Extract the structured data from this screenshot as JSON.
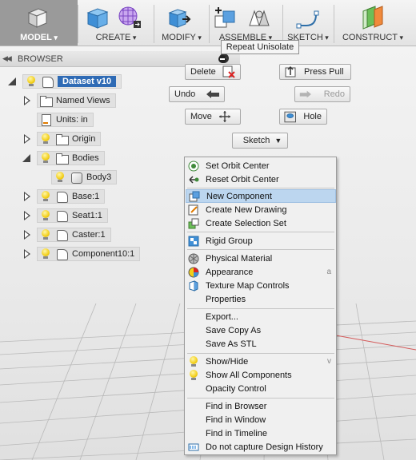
{
  "toolbar": {
    "groups": [
      {
        "label": "MODEL",
        "icon": "model-cube-icon"
      },
      {
        "label": "CREATE",
        "icon": "create-box-icon"
      },
      {
        "label": "MODIFY",
        "icon": "modify-icon"
      },
      {
        "label": "ASSEMBLE",
        "icon": "assemble-icon"
      },
      {
        "label": "SKETCH",
        "icon": "sketch-icon"
      },
      {
        "label": "CONSTRUCT",
        "icon": "construct-icon"
      }
    ]
  },
  "browser": {
    "title": "BROWSER",
    "items": [
      {
        "label": "Dataset v10",
        "icon": "component-icon",
        "visible_bulb": true,
        "expanded": true,
        "selected": true
      },
      {
        "label": "Named Views",
        "icon": "folder-icon",
        "expanded": false
      },
      {
        "label": "Units: in",
        "icon": "document-icon"
      },
      {
        "label": "Origin",
        "icon": "folder-icon",
        "visible_bulb": true,
        "expanded": false
      },
      {
        "label": "Bodies",
        "icon": "folder-icon",
        "visible_bulb": true,
        "expanded": true
      },
      {
        "label": "Body3",
        "icon": "body-icon",
        "visible_bulb": true
      },
      {
        "label": "Base:1",
        "icon": "component-icon",
        "visible_bulb": true,
        "expanded": false
      },
      {
        "label": "Seat1:1",
        "icon": "component-icon",
        "visible_bulb": true,
        "expanded": false
      },
      {
        "label": "Caster:1",
        "icon": "component-icon",
        "visible_bulb": true,
        "expanded": false
      },
      {
        "label": "Component10:1",
        "icon": "component-icon",
        "visible_bulb": true,
        "expanded": false
      }
    ]
  },
  "marking_menu": {
    "tooltip": "Repeat Unisolate",
    "buttons": {
      "delete": "Delete",
      "press_pull": "Press Pull",
      "undo": "Undo",
      "redo": "Redo",
      "move": "Move",
      "hole": "Hole",
      "sketch": "Sketch"
    }
  },
  "context_menu": {
    "groups": [
      [
        {
          "label": "Set Orbit Center",
          "icon": "orbit-center-icon"
        },
        {
          "label": "Reset Orbit Center",
          "icon": "reset-orbit-icon"
        }
      ],
      [
        {
          "label": "New Component",
          "icon": "new-component-icon",
          "highlighted": true
        },
        {
          "label": "Create New Drawing",
          "icon": "new-drawing-icon"
        },
        {
          "label": "Create Selection Set",
          "icon": "selection-set-icon"
        }
      ],
      [
        {
          "label": "Rigid Group",
          "icon": "rigid-group-icon"
        }
      ],
      [
        {
          "label": "Physical Material",
          "icon": "physical-material-icon"
        },
        {
          "label": "Appearance",
          "icon": "appearance-icon",
          "shortcut": "a"
        },
        {
          "label": "Texture Map Controls",
          "icon": "texture-map-icon"
        },
        {
          "label": "Properties",
          "icon": ""
        }
      ],
      [
        {
          "label": "Export...",
          "icon": ""
        },
        {
          "label": "Save Copy As",
          "icon": ""
        },
        {
          "label": "Save As STL",
          "icon": ""
        }
      ],
      [
        {
          "label": "Show/Hide",
          "icon": "lightbulb-icon",
          "shortcut": "v"
        },
        {
          "label": "Show All Components",
          "icon": "lightbulb-icon"
        },
        {
          "label": "Opacity Control",
          "icon": ""
        }
      ],
      [
        {
          "label": "Find in Browser",
          "icon": ""
        },
        {
          "label": "Find in Window",
          "icon": ""
        },
        {
          "label": "Find in Timeline",
          "icon": ""
        },
        {
          "label": "Do not capture Design History",
          "icon": "design-history-icon"
        }
      ]
    ]
  },
  "colors": {
    "selection_blue": "#2f6bb5",
    "menu_highlight": "#bcd6ef",
    "bulb_yellow": "#f3cf19"
  }
}
